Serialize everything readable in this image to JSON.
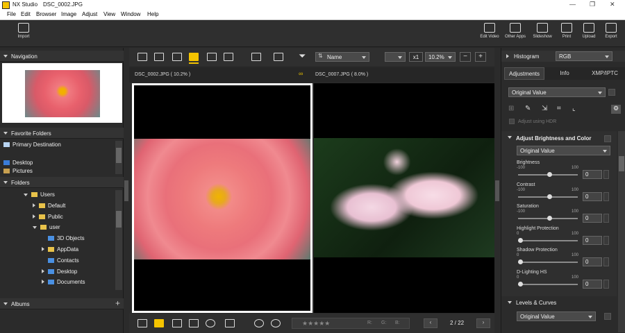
{
  "window": {
    "app": "NX Studio",
    "file": "DSC_0002.JPG"
  },
  "menu": [
    "File",
    "Edit",
    "Browser",
    "Image",
    "Adjust",
    "View",
    "Window",
    "Help"
  ],
  "toolbar": {
    "import": "Import",
    "edit_video": "Edit Video",
    "other_apps": "Other Apps",
    "slideshow": "Slideshow",
    "print": "Print",
    "upload": "Upload",
    "export": "Export"
  },
  "left": {
    "navigation": "Navigation",
    "favorites": "Favorite Folders",
    "fav_items": [
      "Primary Destination",
      "Desktop",
      "Pictures"
    ],
    "folders": "Folders",
    "tree": [
      {
        "label": "Users",
        "level": 0,
        "expanded": true
      },
      {
        "label": "Default",
        "level": 1,
        "expanded": false
      },
      {
        "label": "Public",
        "level": 1,
        "expanded": false
      },
      {
        "label": "user",
        "level": 1,
        "expanded": true
      },
      {
        "label": "3D Objects",
        "level": 2,
        "expanded": null
      },
      {
        "label": "AppData",
        "level": 2,
        "expanded": false
      },
      {
        "label": "Contacts",
        "level": 2,
        "expanded": null
      },
      {
        "label": "Desktop",
        "level": 2,
        "expanded": false
      },
      {
        "label": "Documents",
        "level": 2,
        "expanded": false
      }
    ],
    "albums": "Albums"
  },
  "viewer": {
    "sort": "Name",
    "zoom": "10.2%",
    "scale": "x1",
    "left_caption": "DSC_0002.JPG ( 10.2% )",
    "right_caption": "DSC_0007.JPG ( 8.0% )",
    "nav": "2 / 22",
    "rgb": {
      "r": "R:",
      "g": "G:",
      "b": "B:"
    }
  },
  "right": {
    "histogram": "Histogram",
    "hist_mode": "RGB",
    "tabs": [
      "Adjustments",
      "Info",
      "XMP/IPTC"
    ],
    "preset": "Original Value",
    "hdr": "Adjust using HDR",
    "bc_title": "Adjust Brightness and Color",
    "bc_preset": "Original Value",
    "sliders": [
      {
        "label": "Brightness",
        "min": "-100",
        "max": "100",
        "value": "0",
        "pos": 0.5
      },
      {
        "label": "Contrast",
        "min": "-100",
        "max": "100",
        "value": "0",
        "pos": 0.5
      },
      {
        "label": "Saturation",
        "min": "-100",
        "max": "100",
        "value": "0",
        "pos": 0.5
      },
      {
        "label": "Highlight Protection",
        "min": "0",
        "max": "100",
        "value": "0",
        "pos": 0
      },
      {
        "label": "Shadow Protection",
        "min": "0",
        "max": "100",
        "value": "0",
        "pos": 0
      },
      {
        "label": "D-Lighting HS",
        "min": "0",
        "max": "100",
        "value": "0",
        "pos": 0
      }
    ],
    "lc_title": "Levels & Curves",
    "lc_preset": "Original Value"
  }
}
